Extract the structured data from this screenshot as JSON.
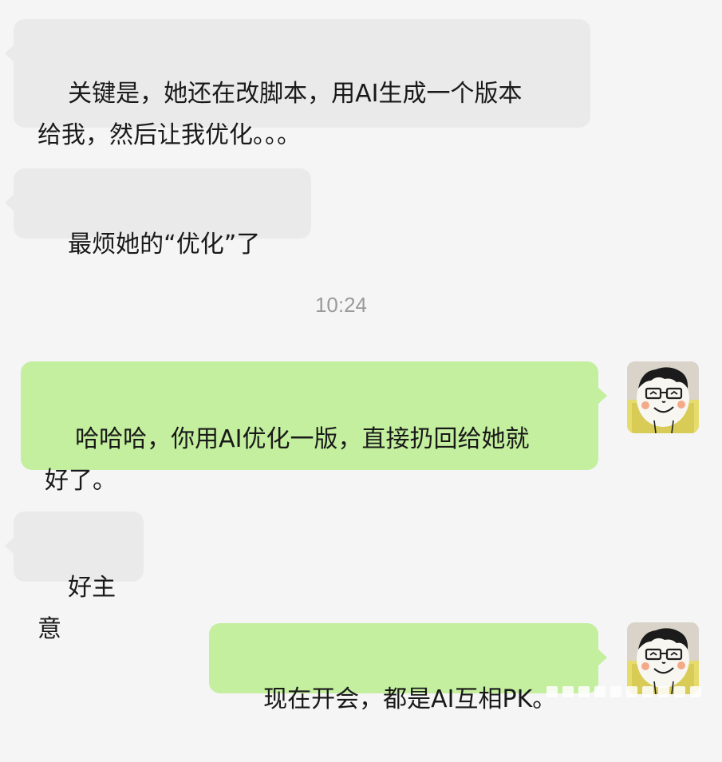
{
  "conversation": {
    "messages": [
      {
        "sender": "other",
        "text": "关键是，她还在改脚本，用AI生成一个版本\n给我，然后让我优化。。。"
      },
      {
        "sender": "other",
        "text": "最烦她的“优化”了"
      },
      {
        "sender": "me",
        "text": "哈哈哈，你用AI优化一版，直接扔回给她就\n好了。"
      },
      {
        "sender": "other",
        "text": "好主意"
      },
      {
        "sender": "me",
        "text": "现在开会，都是AI互相PK。"
      }
    ],
    "timestamp": "10:24"
  },
  "colors": {
    "background": "#f5f5f5",
    "incoming_bubble": "#eaeaea",
    "outgoing_bubble": "#c3ef9e",
    "timestamp_text": "#9a9a9a"
  },
  "icons": {
    "avatar": "cartoon-face-with-glasses-icon"
  }
}
